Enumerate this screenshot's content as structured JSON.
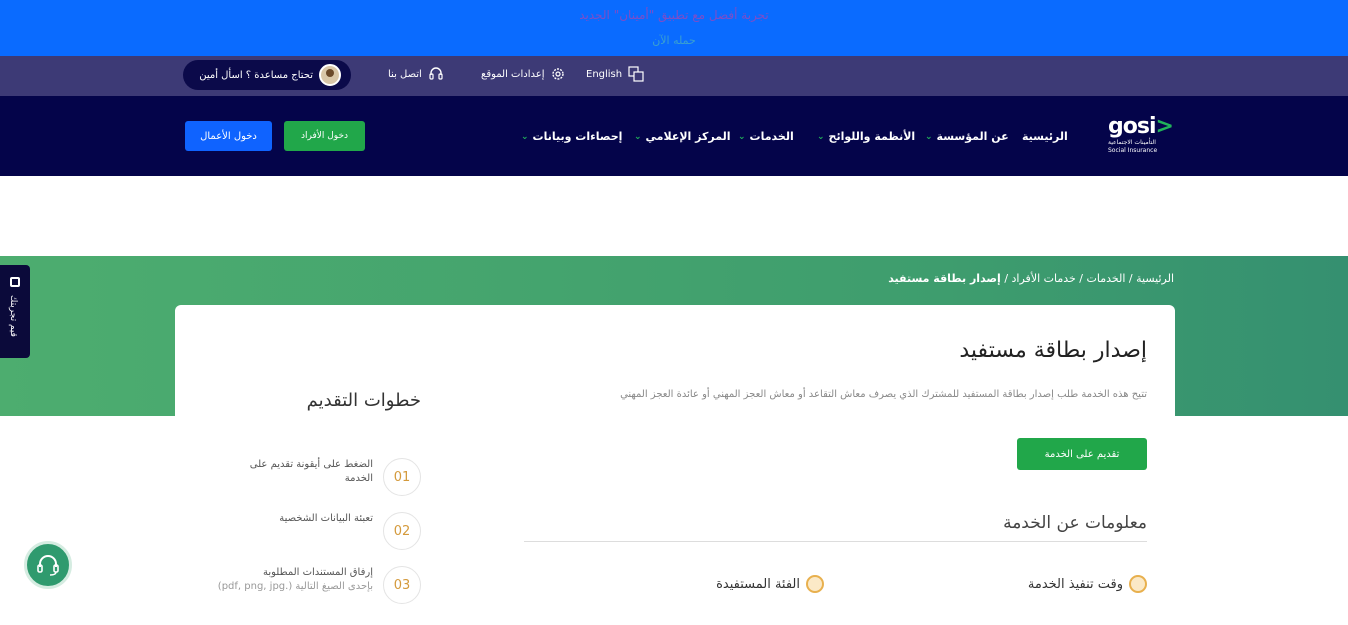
{
  "banner": {
    "line1": "تجربة أفضل مع تطبيق \"أمينان\" الجديد",
    "line2": "حمله الآن"
  },
  "topbar": {
    "help_text": "تحتاج مساعدة ؟ اسأل أمين",
    "contact": "اتصل بنا",
    "settings": "إعدادات الموقع",
    "language": "English"
  },
  "nav": {
    "logo_word": "gosi",
    "logo_sub_ar": "التأمينات الاجتماعية",
    "logo_sub_en": "Social Insurance",
    "items": [
      {
        "label": "الرئيسية"
      },
      {
        "label": "عن المؤسسة"
      },
      {
        "label": "الأنظمة واللوائح"
      },
      {
        "label": "الخدمات"
      },
      {
        "label": "المركز الإعلامي"
      },
      {
        "label": "إحصاءات وبيانات"
      }
    ],
    "individuals_login": "دخول الأفراد",
    "business_login": "دخول الأعمال"
  },
  "side_tab": {
    "label": "قيم تجربتك"
  },
  "breadcrumb": {
    "home": "الرئيسية",
    "services": "الخدمات",
    "individual_services": "خدمات الأفراد",
    "current": "إصدار بطاقة مستفيد",
    "sep": " / "
  },
  "page": {
    "title": "إصدار بطاقة مستفيد",
    "description": "تتيح هذه الخدمة طلب إصدار بطاقة المستفيد للمشترك الذي يصرف معاش التقاعد أو معاش العجز المهني أو عائدة العجز المهني",
    "apply_button": "تقديم على الخدمة",
    "info_title": "معلومات عن الخدمة",
    "info_items": [
      {
        "label": "وقت تنفيذ الخدمة"
      },
      {
        "label": "الفئة المستفيدة"
      }
    ]
  },
  "steps": {
    "title": "خطوات التقديم",
    "items": [
      {
        "num": "01",
        "text": "الضغط على أيقونة تقديم على الخدمة",
        "sub": ""
      },
      {
        "num": "02",
        "text": "تعبئة البيانات الشخصية",
        "sub": ""
      },
      {
        "num": "03",
        "text": "إرفاق المستندات المطلوبة",
        "sub": "بإحدى الصيغ التالية (.pdf, png, jpg)"
      }
    ]
  },
  "colors": {
    "banner": "#0a6bff",
    "topbar": "#3d3a76",
    "nav": "#04044a",
    "green": "#21a74a",
    "blue_btn": "#0f63ff"
  }
}
